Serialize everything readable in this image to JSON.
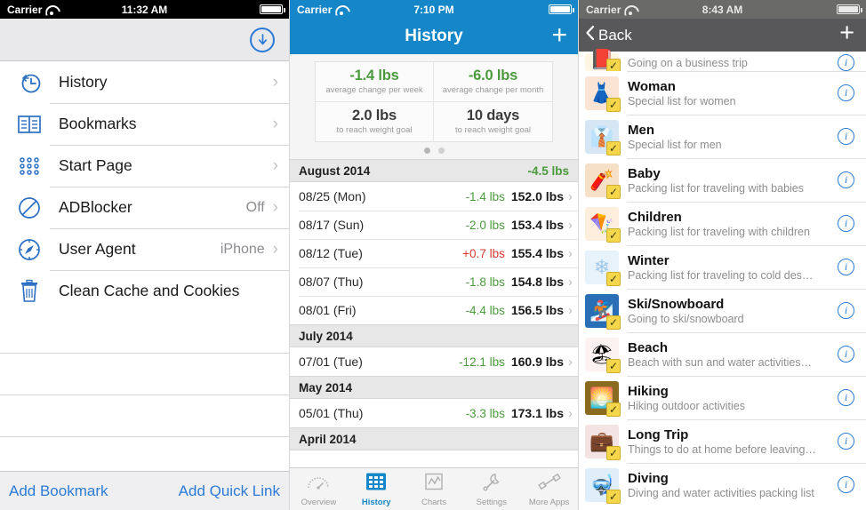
{
  "panel1": {
    "status": {
      "carrier": "Carrier",
      "time": "11:32 AM",
      "wifi_icon": "wifi-icon",
      "battery_icon": "battery-icon"
    },
    "toolbar": {
      "download_icon": "download-arrow-icon"
    },
    "rows": [
      {
        "icon": "history-clock-icon",
        "label": "History",
        "detail": "",
        "chevron": "›"
      },
      {
        "icon": "bookmarks-book-icon",
        "label": "Bookmarks",
        "detail": "",
        "chevron": "›"
      },
      {
        "icon": "start-page-grid-icon",
        "label": "Start Page",
        "detail": "",
        "chevron": "›"
      },
      {
        "icon": "adblocker-no-entry-icon",
        "label": "ADBlocker",
        "detail": "Off",
        "chevron": "›"
      },
      {
        "icon": "user-agent-compass-icon",
        "label": "User Agent",
        "detail": "iPhone",
        "chevron": "›"
      },
      {
        "icon": "trash-can-icon",
        "label": "Clean Cache and Cookies",
        "detail": "",
        "chevron": ""
      }
    ],
    "footer": {
      "left": "Add Bookmark",
      "right": "Add Quick Link"
    }
  },
  "panel2": {
    "status": {
      "carrier": "Carrier",
      "time": "7:10 PM",
      "wifi_icon": "wifi-icon",
      "battery_icon": "battery-icon"
    },
    "nav": {
      "title": "History",
      "add_icon": "+"
    },
    "stats": [
      {
        "value": "-1.4 lbs",
        "label": "average change per week",
        "color": "#4a9a3c"
      },
      {
        "value": "-6.0 lbs",
        "label": "average change per month",
        "color": "#4a9a3c"
      },
      {
        "value": "2.0 lbs",
        "label": "to reach weight goal",
        "color": "#3b3b3b"
      },
      {
        "value": "10 days",
        "label": "to reach weight goal",
        "color": "#3b3b3b"
      }
    ],
    "pager": {
      "count": 2,
      "active": 0
    },
    "sections": [
      {
        "title": "August 2014",
        "total": "-4.5 lbs",
        "total_color": "#4a9a3c",
        "rows": [
          {
            "date": "08/25 (Mon)",
            "delta": "-1.4 lbs",
            "delta_color": "#4a9a3c",
            "weight": "152.0 lbs"
          },
          {
            "date": "08/17 (Sun)",
            "delta": "-2.0 lbs",
            "delta_color": "#4a9a3c",
            "weight": "153.4 lbs"
          },
          {
            "date": "08/12 (Tue)",
            "delta": "+0.7 lbs",
            "delta_color": "#d63b2f",
            "weight": "155.4 lbs"
          },
          {
            "date": "08/07 (Thu)",
            "delta": "-1.8 lbs",
            "delta_color": "#4a9a3c",
            "weight": "154.8 lbs"
          },
          {
            "date": "08/01 (Fri)",
            "delta": "-4.4 lbs",
            "delta_color": "#4a9a3c",
            "weight": "156.5 lbs"
          }
        ]
      },
      {
        "title": "July 2014",
        "total": "",
        "total_color": "#4a9a3c",
        "rows": [
          {
            "date": "07/01 (Tue)",
            "delta": "-12.1 lbs",
            "delta_color": "#4a9a3c",
            "weight": "160.9 lbs"
          }
        ]
      },
      {
        "title": "May 2014",
        "total": "",
        "total_color": "#4a9a3c",
        "rows": [
          {
            "date": "05/01 (Thu)",
            "delta": "-3.3 lbs",
            "delta_color": "#4a9a3c",
            "weight": "173.1 lbs"
          }
        ]
      },
      {
        "title": "April 2014",
        "total": "",
        "total_color": "#4a9a3c",
        "rows": []
      }
    ],
    "tabs": [
      {
        "label": "Overview",
        "icon": "speedometer-icon",
        "active": false
      },
      {
        "label": "History",
        "icon": "calendar-icon",
        "active": true
      },
      {
        "label": "Charts",
        "icon": "line-chart-icon",
        "active": false
      },
      {
        "label": "Settings",
        "icon": "wrench-icon",
        "active": false
      },
      {
        "label": "More Apps",
        "icon": "dumbbell-icon",
        "active": false
      }
    ]
  },
  "panel3": {
    "status": {
      "carrier": "Carrier",
      "time": "8:43 AM",
      "wifi_icon": "wifi-icon",
      "battery_icon": "battery-icon"
    },
    "nav": {
      "back_label": "Back",
      "back_icon": "chevron-left-icon",
      "add_icon": "+"
    },
    "rows": [
      {
        "title": "",
        "subtitle": "Going on a business trip",
        "emoji": "📕",
        "bg": "#fdf6e3",
        "partial": true
      },
      {
        "title": "Woman",
        "subtitle": "Special list for women",
        "emoji": "👗",
        "bg": "#fbe4d4",
        "partial": false
      },
      {
        "title": "Men",
        "subtitle": "Special list for men",
        "emoji": "👔",
        "bg": "#d6e6f5",
        "partial": false
      },
      {
        "title": "Baby",
        "subtitle": "Packing list for traveling with babies",
        "emoji": "🧸",
        "bg": "#f7e0c8",
        "partial": false
      },
      {
        "title": "Children",
        "subtitle": "Packing list for traveling with children",
        "emoji": "🪁",
        "bg": "#fdeede",
        "partial": false
      },
      {
        "title": "Winter",
        "subtitle": "Packing list for traveling to cold des…",
        "emoji": "❄",
        "bg": "#e8f2fa",
        "partial": false
      },
      {
        "title": "Ski/Snowboard",
        "subtitle": "Going to ski/snowboard",
        "emoji": "🏂",
        "bg": "#2a6fb5",
        "partial": false
      },
      {
        "title": "Beach",
        "subtitle": "Beach with sun and water activities…",
        "emoji": "🏖",
        "bg": "#fdf2f2",
        "partial": false
      },
      {
        "title": "Hiking",
        "subtitle": "Hiking outdoor activities",
        "emoji": "🌅",
        "bg": "#6b5a2a",
        "partial": false
      },
      {
        "title": "Long Trip",
        "subtitle": "Things to do at home before leaving…",
        "emoji": "💼",
        "bg": "#f3e3e3",
        "partial": false
      },
      {
        "title": "Diving",
        "subtitle": "Diving and water activities packing list",
        "emoji": "🤿",
        "bg": "#e0eefa",
        "partial": false
      }
    ],
    "info_icon_label": "i"
  }
}
